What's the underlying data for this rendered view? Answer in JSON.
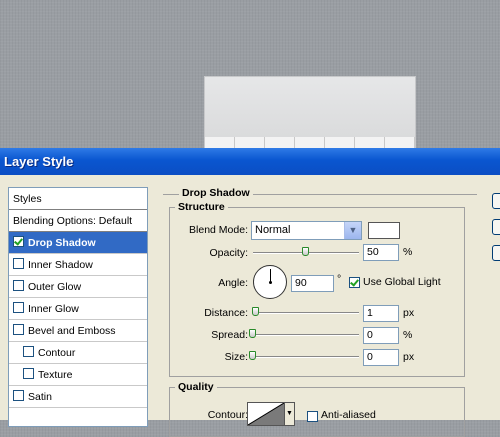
{
  "window": {
    "title": "Layer Style"
  },
  "styles_list": {
    "header": "Styles",
    "blending_options": "Blending Options: Default",
    "items": [
      {
        "label": "Drop Shadow",
        "checked": true,
        "selected": true,
        "indent": false
      },
      {
        "label": "Inner Shadow",
        "checked": false,
        "selected": false,
        "indent": false
      },
      {
        "label": "Outer Glow",
        "checked": false,
        "selected": false,
        "indent": false
      },
      {
        "label": "Inner Glow",
        "checked": false,
        "selected": false,
        "indent": false
      },
      {
        "label": "Bevel and Emboss",
        "checked": false,
        "selected": false,
        "indent": false
      },
      {
        "label": "Contour",
        "checked": false,
        "selected": false,
        "indent": true
      },
      {
        "label": "Texture",
        "checked": false,
        "selected": false,
        "indent": true
      },
      {
        "label": "Satin",
        "checked": false,
        "selected": false,
        "indent": false
      }
    ]
  },
  "drop_shadow": {
    "title": "Drop Shadow",
    "structure": {
      "title": "Structure",
      "blend_mode_label": "Blend Mode:",
      "blend_mode_value": "Normal",
      "shadow_color": "#ffffff",
      "opacity_label": "Opacity:",
      "opacity_value": "50",
      "opacity_unit": "%",
      "opacity_level": 0.5,
      "angle_label": "Angle:",
      "angle_value": "90",
      "angle_unit": "°",
      "use_global_light_label": "Use Global Light",
      "use_global_light_checked": true,
      "distance_label": "Distance:",
      "distance_value": "1",
      "distance_unit": "px",
      "distance_level": 0.03,
      "spread_label": "Spread:",
      "spread_value": "0",
      "spread_unit": "%",
      "spread_level": 0.0,
      "size_label": "Size:",
      "size_value": "0",
      "size_unit": "px",
      "size_level": 0.0
    },
    "quality": {
      "title": "Quality",
      "contour_label": "Contour:",
      "anti_aliased_label": "Anti-aliased",
      "anti_aliased_checked": false
    }
  },
  "colors": {
    "titlebar": "#0a56d0",
    "selection": "#316ac5",
    "dialog_bg": "#ece9d8"
  },
  "icons": {
    "dropdown": "chevron-down-icon",
    "checkbox_check": "check-icon"
  }
}
